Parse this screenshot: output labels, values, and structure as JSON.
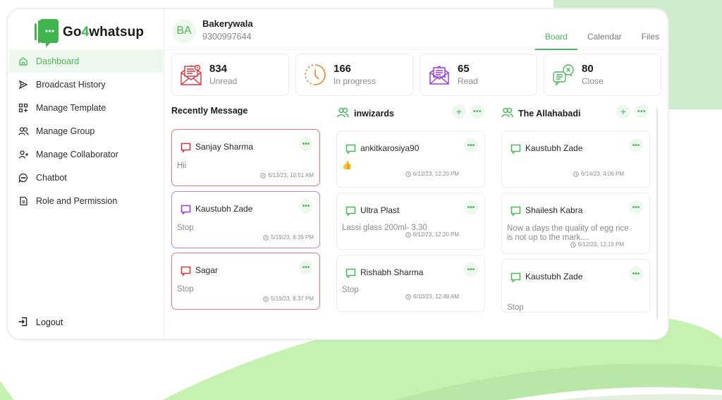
{
  "brand": {
    "name_prefix": "Go",
    "name_four": "4",
    "name_suffix": "whatsup",
    "accent": "#4cb85a"
  },
  "sidebar": {
    "items": [
      {
        "label": "Dashboard",
        "icon": "home-icon",
        "active": true
      },
      {
        "label": "Broadcast History",
        "icon": "send-icon"
      },
      {
        "label": "Manage Template",
        "icon": "template-grid-icon"
      },
      {
        "label": "Manage Group",
        "icon": "users-icon"
      },
      {
        "label": "Manage Collaborator",
        "icon": "user-plus-icon"
      },
      {
        "label": "Chatbot",
        "icon": "chat-bubble-icon"
      },
      {
        "label": "Role and Permission",
        "icon": "document-icon"
      }
    ],
    "logout_label": "Logout"
  },
  "header": {
    "avatar_initials": "BA",
    "business_name": "Bakerywala",
    "phone": "9300997644",
    "tabs": [
      {
        "label": "Board",
        "active": true
      },
      {
        "label": "Calendar"
      },
      {
        "label": "Files"
      }
    ]
  },
  "stats": [
    {
      "value": "834",
      "label": "Unread",
      "icon": "envelope-alert-icon",
      "color": "#d9363e"
    },
    {
      "value": "166",
      "label": "In progress",
      "icon": "clock-progress-icon",
      "color": "#e8892b"
    },
    {
      "value": "65",
      "label": "Read",
      "icon": "envelope-open-icon",
      "color": "#9b3fd6"
    },
    {
      "value": "80",
      "label": "Close",
      "icon": "chat-close-icon",
      "color": "#4cb85a"
    }
  ],
  "columns": [
    {
      "title": "Recently Message",
      "cards": [
        {
          "name": "Sanjay Sharma",
          "message": "Hii",
          "time": "6/13/23, 10:51 AM",
          "color": "#d9363e"
        },
        {
          "name": "Kaustubh Zade",
          "message": "Stop",
          "time": "5/19/23, 8:39 PM",
          "color": "#9b3fd6"
        },
        {
          "name": "Sagar",
          "message": "Stop",
          "time": "5/19/23, 8:37 PM",
          "color": "#d9363e"
        }
      ]
    },
    {
      "title": "inwizards",
      "add_label": "+",
      "cards": [
        {
          "name": "ankitkarosiya90",
          "message": "👍",
          "time": "6/12/23, 12:20 PM"
        },
        {
          "name": "Ultra Plast",
          "message": "Lassi glass 200ml- 3.30",
          "time": "6/12/23, 12:20 PM"
        },
        {
          "name": "Rishabh Sharma",
          "message": "Stop",
          "time": "6/10/23, 12:48 AM"
        }
      ]
    },
    {
      "title": "The Allahabadi",
      "add_label": "+",
      "cards": [
        {
          "name": "Kaustubh Zade",
          "message": "",
          "time": "6/14/23, 4:06 PM"
        },
        {
          "name": "Shailesh Kabra",
          "message": "Now a days the quality of egg rice is not up to the mark....",
          "time": "6/12/23, 12:19 PM"
        },
        {
          "name": "Kaustubh Zade",
          "message": "Stop",
          "time": ""
        }
      ]
    }
  ],
  "more_label": "•••"
}
